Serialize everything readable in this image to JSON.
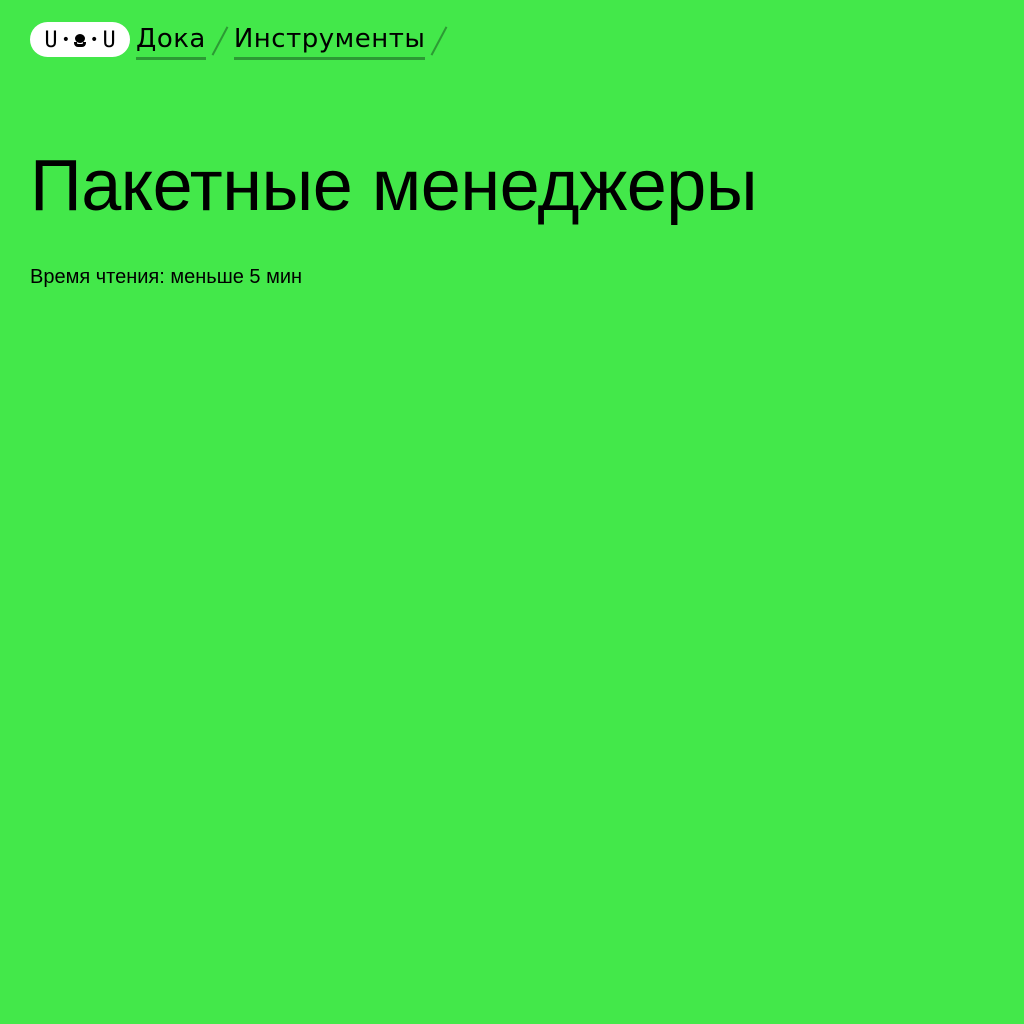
{
  "logo": {
    "left_eye": "U",
    "right_eye": "U",
    "dot": "•",
    "icon": "doka-dog-face-icon"
  },
  "breadcrumb": {
    "items": [
      {
        "label": "Дока"
      },
      {
        "label": "Инструменты"
      }
    ]
  },
  "article": {
    "title": "Пакетные менеджеры",
    "reading_time": "Время чтения: меньше 5 мин"
  },
  "colors": {
    "background": "#43e84a",
    "text": "#000000",
    "accent_underline": "#2c9a34",
    "logo_background": "#ffffff"
  }
}
